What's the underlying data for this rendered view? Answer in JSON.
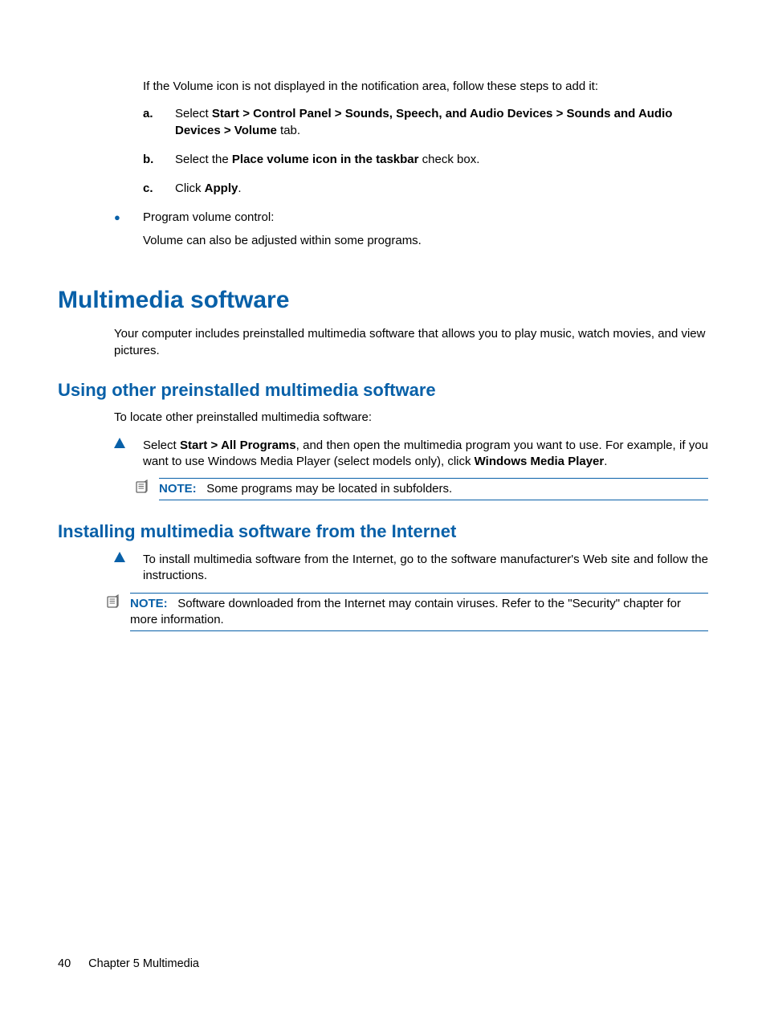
{
  "intro": "If the Volume icon is not displayed in the notification area, follow these steps to add it:",
  "steps": {
    "a": {
      "marker": "a.",
      "pre": "Select ",
      "bold": "Start > Control Panel > Sounds, Speech, and Audio Devices > Sounds and Audio Devices > Volume",
      "post": " tab."
    },
    "b": {
      "marker": "b.",
      "pre": "Select the ",
      "bold": "Place volume icon in the taskbar",
      "post": " check box."
    },
    "c": {
      "marker": "c.",
      "pre": "Click ",
      "bold": "Apply",
      "post": "."
    }
  },
  "bullet": {
    "title": "Program volume control:",
    "body": "Volume can also be adjusted within some programs."
  },
  "h1": "Multimedia software",
  "h1_body": "Your computer includes preinstalled multimedia software that allows you to play music, watch movies, and view pictures.",
  "s1": {
    "heading": "Using other preinstalled multimedia software",
    "lead": "To locate other preinstalled multimedia software:",
    "tri_pre": "Select ",
    "tri_bold1": "Start > All Programs",
    "tri_mid": ", and then open the multimedia program you want to use. For example, if you want to use Windows Media Player (select models only), click ",
    "tri_bold2": "Windows Media Player",
    "tri_post": ".",
    "note_label": "NOTE:",
    "note_text": "Some programs may be located in subfolders."
  },
  "s2": {
    "heading": "Installing multimedia software from the Internet",
    "tri": "To install multimedia software from the Internet, go to the software manufacturer's Web site and follow the instructions.",
    "note_label": "NOTE:",
    "note_text": "Software downloaded from the Internet may contain viruses. Refer to the \"Security\" chapter for more information."
  },
  "footer": {
    "page": "40",
    "chapter": "Chapter 5   Multimedia"
  }
}
